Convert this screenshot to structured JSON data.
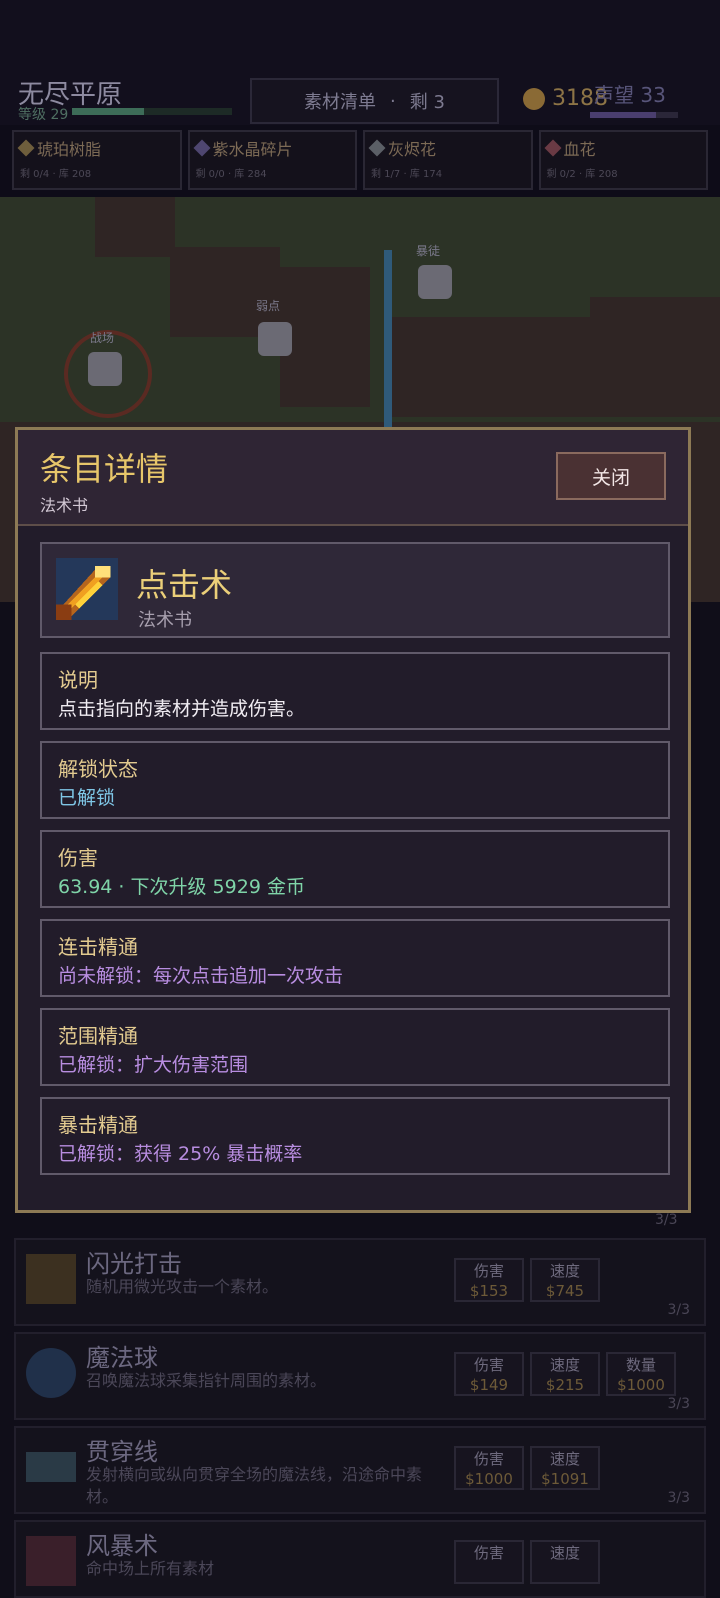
{
  "header": {
    "zone_name": "无尽平原",
    "zone_level": "等级 29",
    "level_progress": 0.45,
    "task": {
      "label": "素材清单",
      "sep": "·",
      "remaining": "剩 3"
    },
    "coins": "3188",
    "fame": "声望 33",
    "fame_progress": 0.75
  },
  "materials": [
    {
      "name": "琥珀树脂",
      "stats": "剩 0/4 · 库 208"
    },
    {
      "name": "紫水晶碎片",
      "stats": "剩 0/0 · 库 284"
    },
    {
      "name": "灰烬花",
      "stats": "剩 1/7 · 库 174"
    },
    {
      "name": "血花",
      "stats": "剩 0/2 · 库 208"
    }
  ],
  "map_labels": [
    "战场",
    "弱点",
    "暴徒"
  ],
  "skills": [
    {
      "name": "闪光打击",
      "desc": "随机用微光攻击一个素材。",
      "buttons": [
        {
          "label": "伤害",
          "price": "$153"
        },
        {
          "label": "速度",
          "price": "$745"
        }
      ],
      "count": "3/3"
    },
    {
      "name": "魔法球",
      "desc": "召唤魔法球采集指针周围的素材。",
      "buttons": [
        {
          "label": "伤害",
          "price": "$149"
        },
        {
          "label": "速度",
          "price": "$215"
        },
        {
          "label": "数量",
          "price": "$1000"
        }
      ],
      "count": "3/3"
    },
    {
      "name": "贯穿线",
      "desc": "发射横向或纵向贯穿全场的魔法线，沿途命中素材。",
      "buttons": [
        {
          "label": "伤害",
          "price": "$1000"
        },
        {
          "label": "速度",
          "price": "$1091"
        }
      ],
      "count": "3/3"
    },
    {
      "name": "风暴术",
      "desc": "命中场上所有素材",
      "buttons": [
        {
          "label": "伤害",
          "price": ""
        },
        {
          "label": "速度",
          "price": ""
        }
      ],
      "count": ""
    }
  ],
  "hidden_count": "3/3",
  "modal": {
    "title": "条目详情",
    "subtitle": "法术书",
    "close_label": "关闭",
    "item": {
      "name": "点击术",
      "type": "法术书"
    },
    "sections": [
      {
        "label": "说明",
        "value": "点击指向的素材并造成伤害。",
        "color": "#f0ecf2"
      },
      {
        "label": "解锁状态",
        "value": "已解锁",
        "color": "#7fc6e6"
      },
      {
        "label": "伤害",
        "value": "63.94  ·  下次升级 5929 金币",
        "color": "#7fd4a8"
      },
      {
        "label": "连击精通",
        "value": "尚未解锁：每次点击追加一次攻击",
        "color": "#b88de0"
      },
      {
        "label": "范围精通",
        "value": "已解锁：扩大伤害范围",
        "color": "#b88de0"
      },
      {
        "label": "暴击精通",
        "value": "已解锁：获得 25% 暴击概率",
        "color": "#b88de0"
      }
    ]
  },
  "colors": {
    "gold_border": "#8d7a55",
    "title_gold": "#e7c66a",
    "panel_bg": "#221c2a"
  },
  "icons": {
    "item": "fire-spell-icon",
    "coin": "coin-icon",
    "close": "close-button"
  }
}
